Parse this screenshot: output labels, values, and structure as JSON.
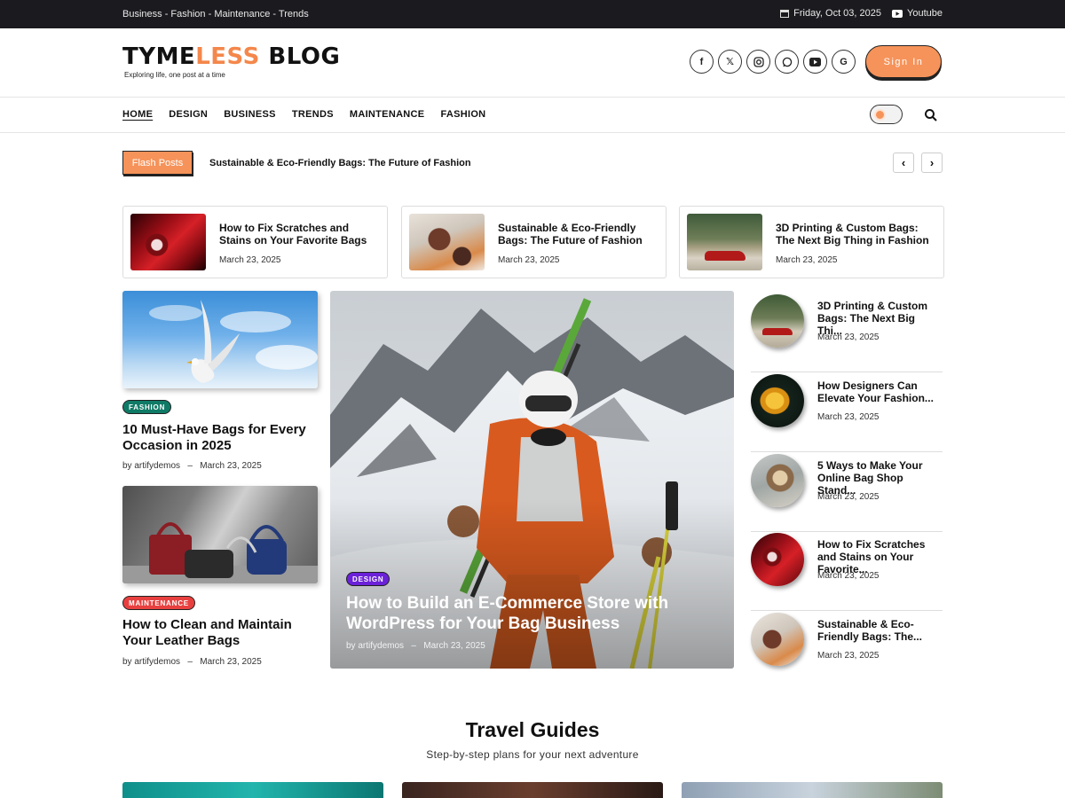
{
  "topbar": {
    "categories": "Business  -  Fashion  -  Maintenance  -  Trends",
    "date": "Friday, Oct 03, 2025",
    "youtube": "Youtube"
  },
  "header": {
    "logo_part1": "TYME",
    "logo_part2": "LESS",
    "logo_part3": " BLOG",
    "tagline": "Exploring life, one post at a time",
    "signin": "Sign In",
    "socials": [
      "facebook-icon",
      "x-icon",
      "instagram-icon",
      "whatsapp-icon",
      "youtube-icon",
      "google-icon"
    ]
  },
  "nav": {
    "items": [
      "HOME",
      "DESIGN",
      "BUSINESS",
      "TRENDS",
      "MAINTENANCE",
      "FASHION"
    ]
  },
  "flash": {
    "label": "Flash Posts",
    "title": "Sustainable & Eco-Friendly Bags: The Future of Fashion"
  },
  "mini_cards": [
    {
      "title": "How to Fix Scratches and Stains on Your Favorite Bags",
      "date": "March 23, 2025"
    },
    {
      "title": "Sustainable & Eco-Friendly Bags: The Future of Fashion",
      "date": "March 23, 2025"
    },
    {
      "title": "3D Printing & Custom Bags: The Next Big Thing in Fashion",
      "date": "March 23, 2025"
    }
  ],
  "left_cards": [
    {
      "badge": "FASHION",
      "title": "10 Must-Have Bags for Every Occasion in 2025",
      "author": "by artifydemos",
      "sep": "–",
      "date": "March 23, 2025"
    },
    {
      "badge": "MAINTENANCE",
      "title": "How to Clean and Maintain Your Leather Bags",
      "author": "by artifydemos",
      "sep": "–",
      "date": "March 23, 2025"
    }
  ],
  "hero": {
    "badge": "DESIGN",
    "title": "How to Build an E-Commerce Store with WordPress for Your Bag Business",
    "author": "by artifydemos",
    "sep": "–",
    "date": "March 23, 2025"
  },
  "right_list": [
    {
      "title": "3D Printing & Custom Bags: The Next Big Thi...",
      "date": "March 23, 2025"
    },
    {
      "title": "How Designers Can Elevate Your Fashion...",
      "date": "March 23, 2025"
    },
    {
      "title": "5 Ways to Make Your Online Bag Shop Stand...",
      "date": "March 23, 2025"
    },
    {
      "title": "How to Fix Scratches and Stains on Your Favorite...",
      "date": "March 23, 2025"
    },
    {
      "title": "Sustainable & Eco-Friendly Bags: The...",
      "date": "March 23, 2025"
    }
  ],
  "section": {
    "title": "Travel Guides",
    "subtitle": "Step-by-step plans for your next adventure"
  },
  "colors": {
    "accent": "#f6935a",
    "fashion_badge": "#0f7a66",
    "maintenance_badge": "#e8403f",
    "design_badge": "#6b21d8"
  }
}
